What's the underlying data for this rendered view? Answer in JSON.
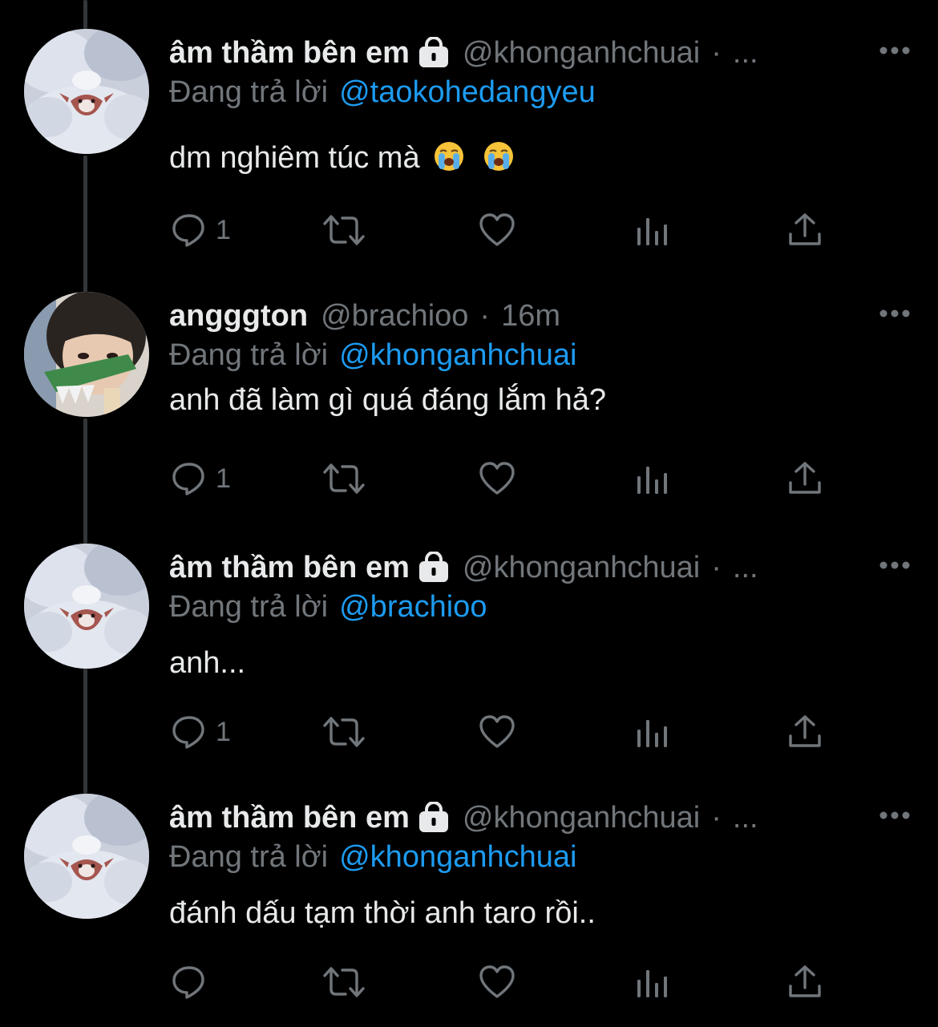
{
  "tweets": [
    {
      "display_name": "âm thầm bên em",
      "locked": true,
      "handle": "@khonganhchuai",
      "separator": "·",
      "time": "...",
      "replying_label": "Đang trả lời",
      "replying_to": "@taokohedangyeu",
      "text": "dm nghiêm túc mà",
      "emojis": [
        "loudly-crying-face",
        "loudly-crying-face"
      ],
      "reply_count": "1",
      "avatar": "bambi-in-snow"
    },
    {
      "display_name": "angggton",
      "locked": false,
      "handle": "@brachioo",
      "separator": "·",
      "time": "16m",
      "replying_label": "Đang trả lời",
      "replying_to": "@khonganhchuai",
      "text": "anh đã làm gì quá đáng lắm hả?",
      "reply_count": "1",
      "avatar": "person-with-toy-crocodile"
    },
    {
      "display_name": "âm thầm bên em",
      "locked": true,
      "handle": "@khonganhchuai",
      "separator": "·",
      "time": "...",
      "replying_label": "Đang trả lời",
      "replying_to": "@brachioo",
      "text": "anh...",
      "reply_count": "1",
      "avatar": "bambi-in-snow"
    },
    {
      "display_name": "âm thầm bên em",
      "locked": true,
      "handle": "@khonganhchuai",
      "separator": "·",
      "time": "...",
      "replying_label": "Đang trả lời",
      "replying_to": "@khonganhchuai",
      "text": "đánh dấu tạm thời anh taro rồi..",
      "reply_count": "",
      "avatar": "bambi-in-snow"
    }
  ],
  "icons": {
    "reply": "reply-icon",
    "retweet": "retweet-icon",
    "like": "heart-icon",
    "views": "analytics-icon",
    "share": "share-icon",
    "more": "more-icon",
    "lock": "lock-icon"
  },
  "colors": {
    "background": "#000000",
    "text": "#e7e9ea",
    "muted": "#71767b",
    "link": "#1d9bf0",
    "thread_line": "#333639"
  }
}
